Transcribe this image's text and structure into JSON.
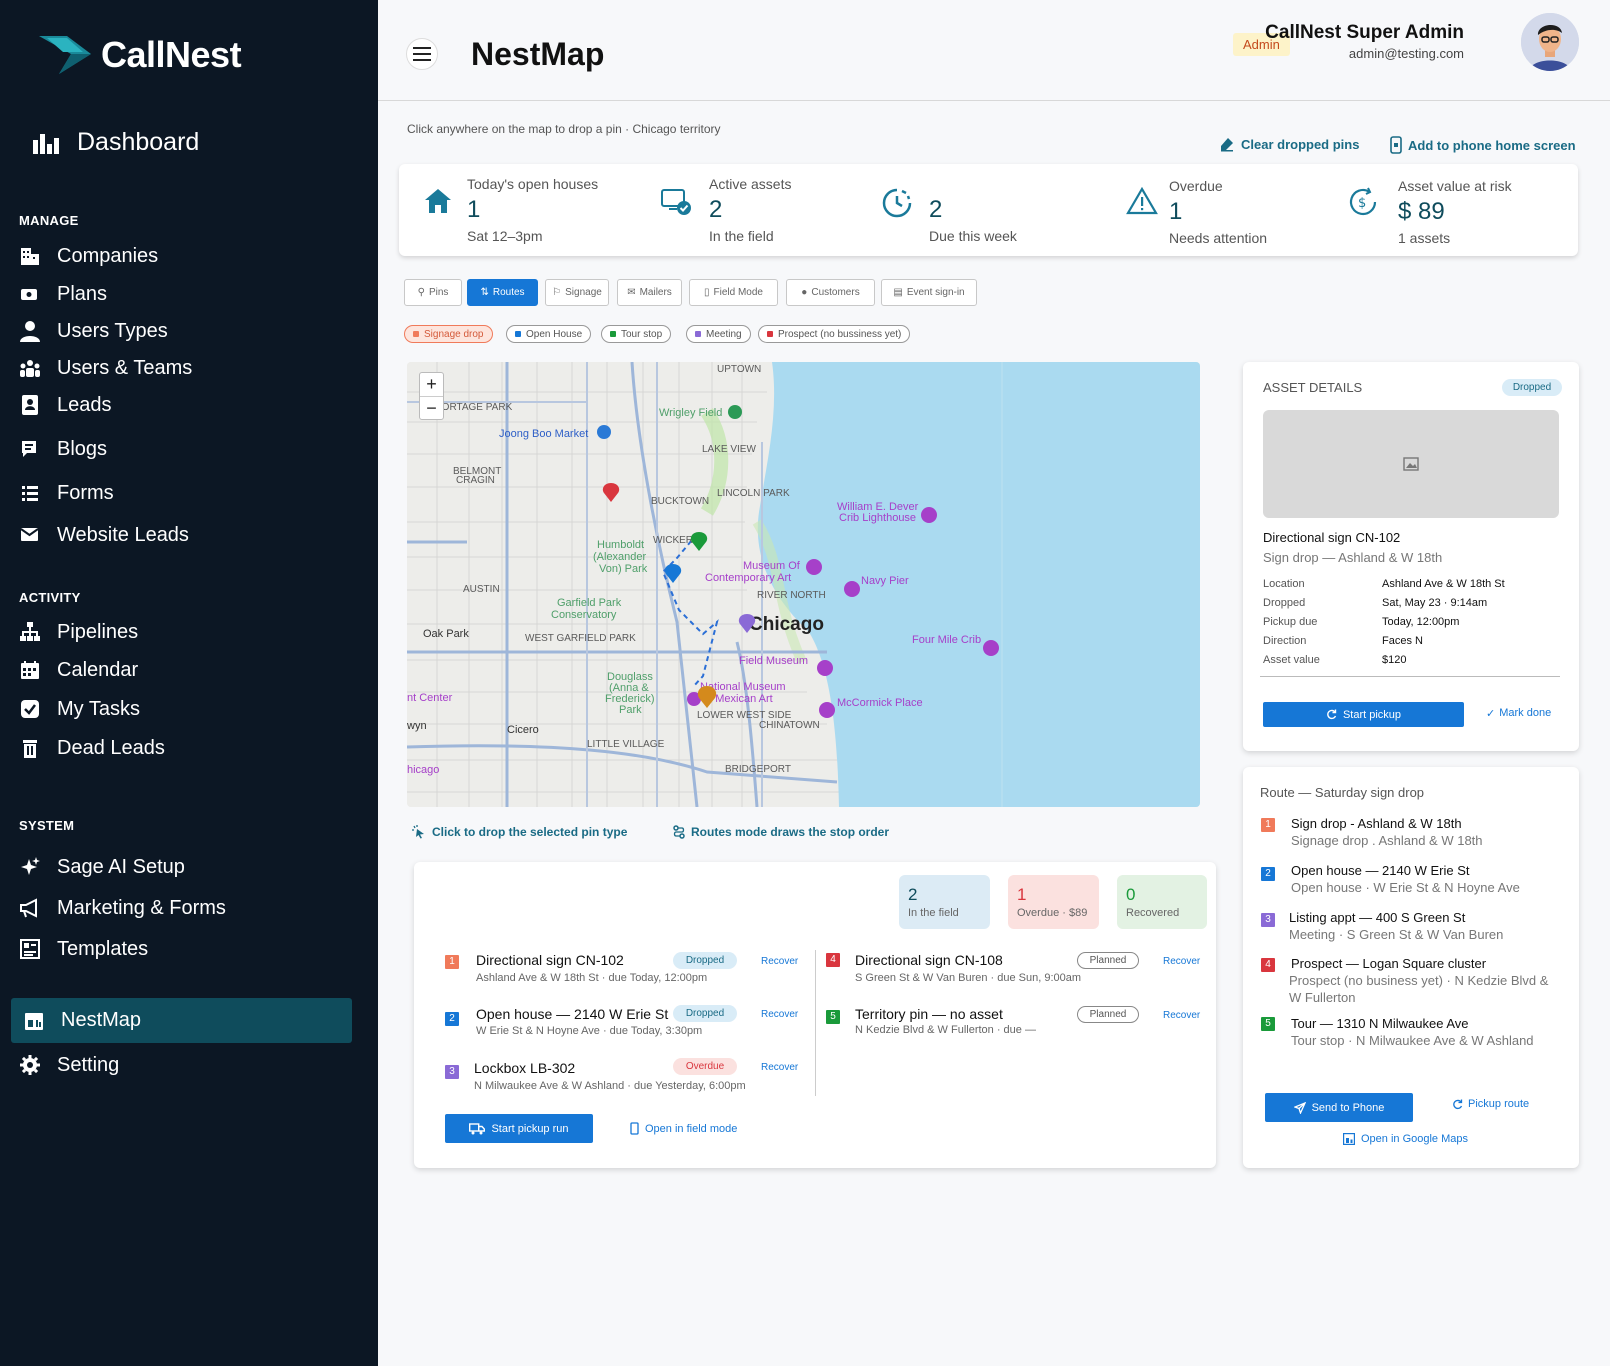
{
  "sidebar": {
    "brand": "CallNest",
    "dashboard": "Dashboard",
    "sections": {
      "manage": "MANAGE",
      "activity": "ACTIVITY",
      "system": "SYSTEM"
    },
    "manage": [
      "Companies",
      "Plans",
      "Users Types",
      "Users & Teams",
      "Leads",
      "Blogs",
      "Forms",
      "Website Leads"
    ],
    "activity": [
      "Pipelines",
      "Calendar",
      "My Tasks",
      "Dead Leads"
    ],
    "system": [
      "Sage AI Setup",
      "Marketing & Forms",
      "Templates",
      "NestMap",
      "Setting"
    ],
    "active": "NestMap"
  },
  "header": {
    "title": "NestMap",
    "role": "Admin",
    "user_name": "CallNest Super Admin",
    "user_email": "admin@testing.com"
  },
  "toolbar": {
    "hint": "Click anywhere on the map to drop a pin · Chicago territory",
    "clear_pins": "Clear dropped pins",
    "add_home": "Add to phone home screen"
  },
  "stats": [
    {
      "label": "Today's open houses",
      "value": "1",
      "sub": "Sat 12–3pm"
    },
    {
      "label": "Active assets",
      "value": "2",
      "sub": "In the field"
    },
    {
      "label": "",
      "value": "2",
      "sub": "Due this week"
    },
    {
      "label": "Overdue",
      "value": "1",
      "sub": "Needs attention"
    },
    {
      "label": "Asset value at risk",
      "value": "$ 89",
      "sub": "1 assets"
    }
  ],
  "modes": [
    "Pins",
    "Routes",
    "Signage",
    "Mailers",
    "Field Mode",
    "Customers",
    "Event sign-in"
  ],
  "active_mode": "Routes",
  "legend": [
    {
      "label": "Signage drop",
      "color": "#f07a5a"
    },
    {
      "label": "Open House",
      "color": "#1677d6"
    },
    {
      "label": "Tour stop",
      "color": "#1a9a3a"
    },
    {
      "label": "Meeting",
      "color": "#8a6ad6"
    },
    {
      "label": "Prospect (no bussiness yet)",
      "color": "#d9363e"
    }
  ],
  "map": {
    "labels": [
      "Wrigley Field",
      "Joong Boo Market",
      "LAKE VIEW",
      "LINCOLN PARK",
      "BUCKTOWN",
      "WICKER P",
      "Humboldt (Alexander Von) Park",
      "Museum Of Contemporary Art",
      "RIVER NORTH",
      "Garfield Park Conservatory",
      "Chicago",
      "Navy Pier",
      "William E. Dever Crib Lighthouse",
      "Four Mile Crib",
      "Field Museum",
      "McCormick Place",
      "Oak Park",
      "AUSTIN",
      "WEST GARFIELD PARK",
      "Douglass (Anna & Frederick) Park",
      "National Museum of Mexican Art",
      "LOWER WEST SIDE",
      "CHINATOWN",
      "Cicero",
      "LITTLE VILLAGE",
      "BRIDGEPORT",
      "PORTAGE PARK",
      "BELMONT CRAGIN",
      "UPTOWN",
      "nt Center",
      "wyn",
      "hicago"
    ],
    "zoom_in": "+",
    "zoom_out": "−",
    "drop_hint": "Click to drop the selected pin type",
    "route_hint": "Routes mode draws the stop order"
  },
  "summary": {
    "kpis": [
      {
        "value": "2",
        "label": "In the field"
      },
      {
        "value": "1",
        "label": "Overdue · $89"
      },
      {
        "value": "0",
        "label": "Recovered"
      }
    ],
    "left": [
      {
        "num": "1",
        "title": "Directional sign CN-102",
        "sub": "Ashland Ave & W 18th St · due Today, 12:00pm",
        "status": "Dropped",
        "action": "Recover",
        "color": "#f07a5a"
      },
      {
        "num": "2",
        "title": "Open house — 2140 W Erie St",
        "sub": "W Erie St & N Hoyne Ave · due Today, 3:30pm",
        "status": "Dropped",
        "action": "Recover",
        "color": "#1677d6"
      },
      {
        "num": "3",
        "title": "Lockbox LB-302",
        "sub": "N Milwaukee Ave & W Ashland · due Yesterday, 6:00pm",
        "status": "Overdue",
        "action": "Recover",
        "color": "#8a6ad6"
      }
    ],
    "right": [
      {
        "num": "4",
        "title": "Directional sign CN-108",
        "sub": "S Green St & W Van Buren · due Sun, 9:00am",
        "status": "Planned",
        "action": "Recover",
        "color": "#d9363e"
      },
      {
        "num": "5",
        "title": "Territory pin — no asset",
        "sub": "N Kedzie Blvd & W Fullerton · due —",
        "status": "Planned",
        "action": "Recover",
        "color": "#1a9a3a"
      }
    ],
    "start_run": "Start pickup run",
    "open_field": "Open in field mode"
  },
  "asset": {
    "heading": "ASSET DETAILS",
    "status": "Dropped",
    "name": "Directional sign CN-102",
    "subtitle": "Sign drop — Ashland & W 18th",
    "fields": [
      {
        "label": "Location",
        "value": "Ashland Ave & W 18th St"
      },
      {
        "label": "Dropped",
        "value": "Sat, May 23 · 9:14am"
      },
      {
        "label": "Pickup due",
        "value": "Today, 12:00pm"
      },
      {
        "label": "Direction",
        "value": "Faces N"
      },
      {
        "label": "Asset value",
        "value": "$120"
      }
    ],
    "start_pickup": "Start pickup",
    "mark_done": "Mark done"
  },
  "route": {
    "heading": "Route — Saturday sign drop",
    "stops": [
      {
        "num": "1",
        "title": "Sign drop - Ashland & W 18th",
        "sub": "Signage drop . Ashland & W 18th",
        "color": "#f07a5a"
      },
      {
        "num": "2",
        "title": "Open house — 2140 W Erie St",
        "sub": "Open house · W Erie St & N Hoyne Ave",
        "color": "#1677d6"
      },
      {
        "num": "3",
        "title": "Listing appt — 400 S Green St",
        "sub": "Meeting · S Green St & W Van Buren",
        "color": "#8a6ad6"
      },
      {
        "num": "4",
        "title": "Prospect — Logan Square cluster",
        "sub": "Prospect (no business yet) · N Kedzie Blvd &",
        "sub2": "W Fullerton",
        "color": "#d9363e"
      },
      {
        "num": "5",
        "title": "Tour — 1310 N Milwaukee Ave",
        "sub": "Tour stop · N Milwaukee Ave & W Ashland",
        "color": "#1a9a3a"
      }
    ],
    "send_phone": "Send to Phone",
    "pickup_route": "Pickup route",
    "google_maps": "Open in Google Maps"
  }
}
